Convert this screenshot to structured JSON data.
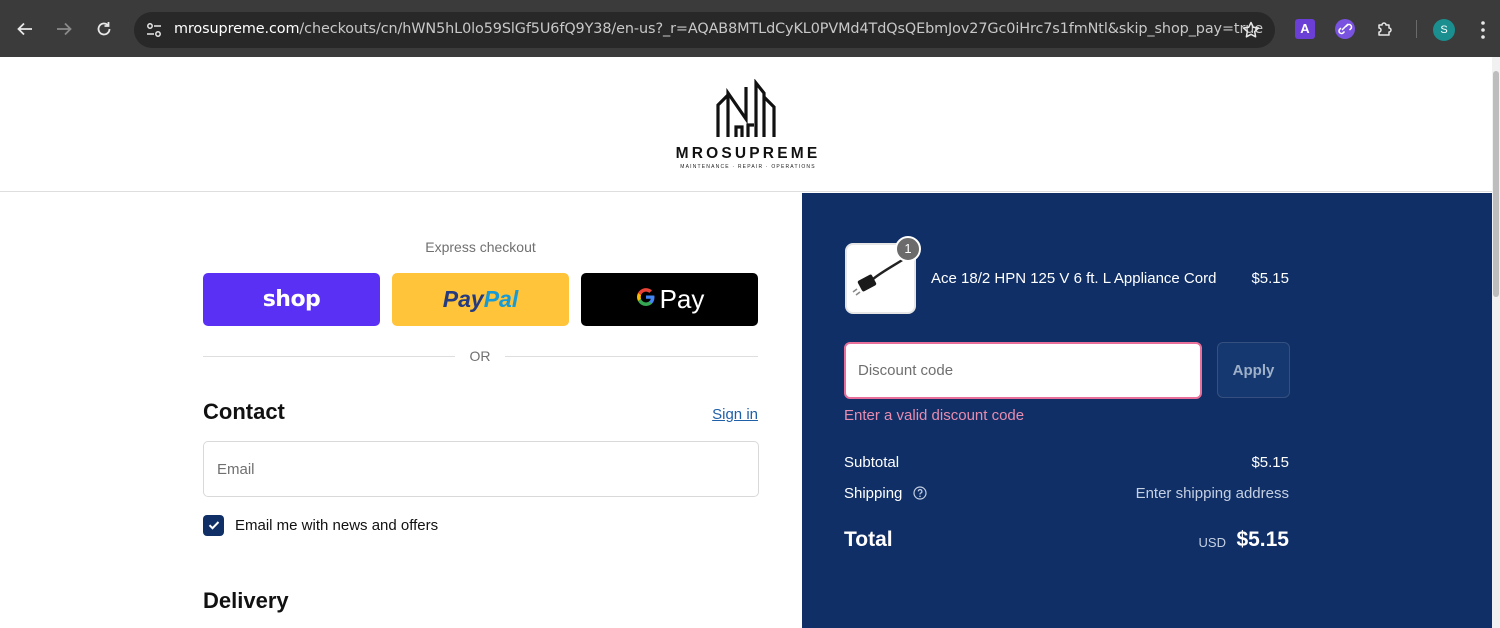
{
  "browser": {
    "url_host": "mrosupreme.com",
    "url_path": "/checkouts/cn/hWN5hL0lo59SlGf5U6fQ9Y38/en-us?_r=AQAB8MTLdCyKL0PVMd4TdQsQEbmJov27Gc0iHrc7s1fmNtl&skip_shop_pay=true",
    "ext_a_label": "A",
    "profile_initial": "S"
  },
  "header": {
    "logo_text": "MROSUPREME",
    "logo_subtext": "MAINTENANCE · REPAIR · OPERATIONS"
  },
  "express": {
    "label": "Express checkout",
    "shop_label": "shop",
    "paypal_part1": "Pay",
    "paypal_part2": "Pal",
    "gpay_g": "G",
    "gpay_label": "Pay",
    "or_text": "OR"
  },
  "contact": {
    "heading": "Contact",
    "sign_in": "Sign in",
    "email_placeholder": "Email",
    "newsletter_label": "Email me with news and offers",
    "newsletter_checked": true
  },
  "delivery": {
    "heading": "Delivery"
  },
  "summary": {
    "item": {
      "name": "Ace 18/2 HPN 125 V 6 ft. L Appliance Cord",
      "price": "$5.15",
      "quantity": "1"
    },
    "discount": {
      "placeholder": "Discount code",
      "apply_label": "Apply",
      "error": "Enter a valid discount code"
    },
    "subtotal_label": "Subtotal",
    "subtotal_value": "$5.15",
    "shipping_label": "Shipping",
    "shipping_value": "Enter shipping address",
    "total_label": "Total",
    "total_currency": "USD",
    "total_value": "$5.15"
  },
  "colors": {
    "summary_bg": "#0f2f66",
    "shop_pay": "#5a31f4",
    "paypal": "#ffc439",
    "error": "#e88cb0"
  }
}
